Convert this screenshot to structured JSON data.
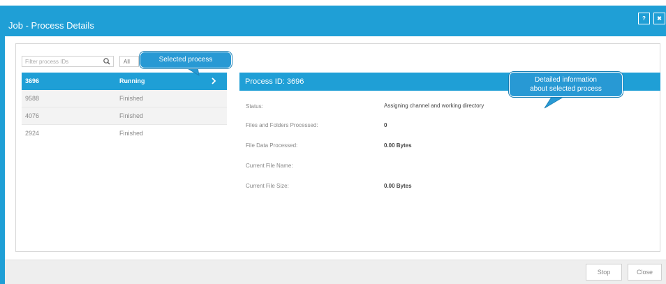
{
  "window": {
    "title": "Job - Process Details",
    "help_label": "?",
    "close_label": "✖"
  },
  "filter": {
    "search_placeholder": "Filter process IDs",
    "status_value": "All"
  },
  "processes": [
    {
      "id": "3696",
      "status": "Running",
      "selected": true
    },
    {
      "id": "9588",
      "status": "Finished"
    },
    {
      "id": "4076",
      "status": "Finished"
    },
    {
      "id": "2924",
      "status": "Finished"
    }
  ],
  "detail": {
    "title": "Process ID: 3696",
    "fields": [
      {
        "label": "Status:",
        "value": "Assigning channel and working directory"
      },
      {
        "label": "Files and Folders Processed:",
        "value": "0"
      },
      {
        "label": "File Data Processed:",
        "value": "0.00 Bytes"
      },
      {
        "label": "Current File Name:",
        "value": ""
      },
      {
        "label": "Current File Size:",
        "value": "0.00 Bytes"
      }
    ]
  },
  "callouts": {
    "selected_process": "Selected process",
    "detailed_info_line1": "Detailed information",
    "detailed_info_line2": "about selected process"
  },
  "footer": {
    "stop_label": "Stop",
    "close_label": "Close"
  },
  "colors": {
    "accent": "#1f9fd6",
    "callout": "#2899d4"
  }
}
